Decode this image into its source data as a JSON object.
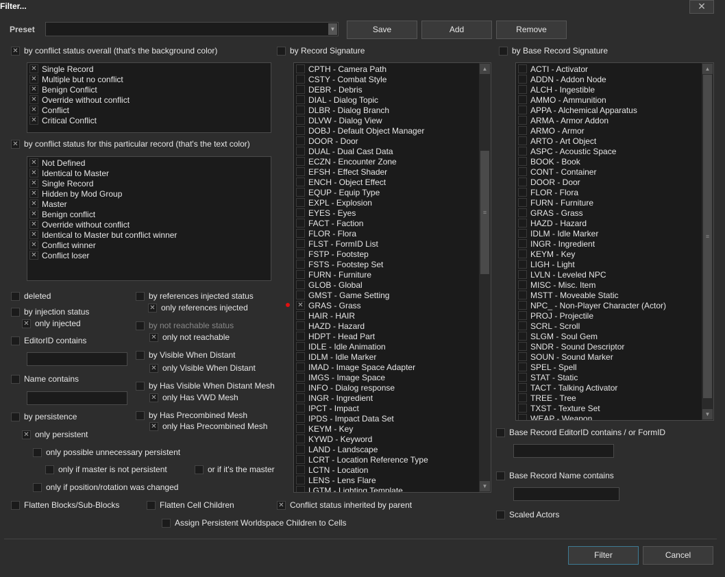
{
  "window": {
    "title": "Filter...",
    "close_label": "✕"
  },
  "preset": {
    "label": "Preset",
    "value": "",
    "save": "Save",
    "add": "Add",
    "remove": "Remove"
  },
  "overall": {
    "label": "by conflict status overall (that's the background color)",
    "checked": true,
    "items": [
      {
        "label": "Single Record",
        "checked": true
      },
      {
        "label": "Multiple but no conflict",
        "checked": true
      },
      {
        "label": "Benign Conflict",
        "checked": true
      },
      {
        "label": "Override without conflict",
        "checked": true
      },
      {
        "label": "Conflict",
        "checked": true
      },
      {
        "label": "Critical Conflict",
        "checked": true
      }
    ]
  },
  "particular": {
    "label": "by conflict status for this particular record  (that's the text color)",
    "checked": true,
    "items": [
      {
        "label": "Not Defined",
        "checked": true
      },
      {
        "label": "Identical to Master",
        "checked": true
      },
      {
        "label": "Single Record",
        "checked": true
      },
      {
        "label": "Hidden by Mod Group",
        "checked": true
      },
      {
        "label": "Master",
        "checked": true
      },
      {
        "label": "Benign conflict",
        "checked": true
      },
      {
        "label": "Override without conflict",
        "checked": true
      },
      {
        "label": "Identical to Master but conflict winner",
        "checked": true
      },
      {
        "label": "Conflict winner",
        "checked": true
      },
      {
        "label": "Conflict loser",
        "checked": true
      }
    ]
  },
  "options": {
    "deleted": "deleted",
    "injection": "by injection status",
    "only_injected": "only injected",
    "editorid": "EditorID contains",
    "editorid_value": "",
    "name": "Name contains",
    "name_value": "",
    "persistence": "by persistence",
    "only_persistent": "only persistent",
    "unnecessary": "only possible unnecessary persistent",
    "master_not_persistent": "only if master is not persistent",
    "or_master": "or if it's the master",
    "pos_changed": "only if position/rotation was changed",
    "refs_injected": "by references injected status",
    "only_refs_injected": "only references injected",
    "not_reachable": "by not reachable status",
    "only_not_reachable": "only not reachable",
    "vwd": "by Visible When Distant",
    "only_vwd": "only Visible When Distant",
    "vwd_mesh": "by Has Visible When Distant Mesh",
    "only_vwd_mesh": "only Has VWD Mesh",
    "precombined": "by Has Precombined Mesh",
    "only_precombined": "only Has Precombined Mesh",
    "flatten_blocks": "Flatten Blocks/Sub-Blocks",
    "flatten_cell": "Flatten Cell Children",
    "inherited": "Conflict status inherited by parent",
    "assign_persistent": "Assign Persistent Worldspace Children to Cells"
  },
  "record_signature": {
    "label": "by Record Signature",
    "checked": false,
    "items": [
      {
        "label": "CPTH - Camera Path"
      },
      {
        "label": "CSTY - Combat Style"
      },
      {
        "label": "DEBR - Debris"
      },
      {
        "label": "DIAL - Dialog Topic"
      },
      {
        "label": "DLBR - Dialog Branch"
      },
      {
        "label": "DLVW - Dialog View"
      },
      {
        "label": "DOBJ - Default Object Manager"
      },
      {
        "label": "DOOR - Door"
      },
      {
        "label": "DUAL - Dual Cast Data"
      },
      {
        "label": "ECZN - Encounter Zone"
      },
      {
        "label": "EFSH - Effect Shader"
      },
      {
        "label": "ENCH - Object Effect"
      },
      {
        "label": "EQUP - Equip Type"
      },
      {
        "label": "EXPL - Explosion"
      },
      {
        "label": "EYES - Eyes"
      },
      {
        "label": "FACT - Faction"
      },
      {
        "label": "FLOR - Flora"
      },
      {
        "label": "FLST - FormID List"
      },
      {
        "label": "FSTP - Footstep"
      },
      {
        "label": "FSTS - Footstep Set"
      },
      {
        "label": "FURN - Furniture"
      },
      {
        "label": "GLOB - Global"
      },
      {
        "label": "GMST - Game Setting"
      },
      {
        "label": "GRAS - Grass",
        "checked": true
      },
      {
        "label": "HAIR - HAIR"
      },
      {
        "label": "HAZD - Hazard"
      },
      {
        "label": "HDPT - Head Part"
      },
      {
        "label": "IDLE - Idle Animation"
      },
      {
        "label": "IDLM - Idle Marker"
      },
      {
        "label": "IMAD - Image Space Adapter"
      },
      {
        "label": "IMGS - Image Space"
      },
      {
        "label": "INFO - Dialog response"
      },
      {
        "label": "INGR - Ingredient"
      },
      {
        "label": "IPCT - Impact"
      },
      {
        "label": "IPDS - Impact Data Set"
      },
      {
        "label": "KEYM - Key"
      },
      {
        "label": "KYWD - Keyword"
      },
      {
        "label": "LAND - Landscape"
      },
      {
        "label": "LCRT - Location Reference Type"
      },
      {
        "label": "LCTN - Location"
      },
      {
        "label": "LENS - Lens Flare"
      },
      {
        "label": "LGTM - Lighting Template"
      }
    ]
  },
  "base_signature": {
    "label": "by Base Record Signature",
    "checked": false,
    "items": [
      {
        "label": "ACTI - Activator"
      },
      {
        "label": "ADDN - Addon Node"
      },
      {
        "label": "ALCH - Ingestible"
      },
      {
        "label": "AMMO - Ammunition"
      },
      {
        "label": "APPA - Alchemical Apparatus"
      },
      {
        "label": "ARMA - Armor Addon"
      },
      {
        "label": "ARMO - Armor"
      },
      {
        "label": "ARTO - Art Object"
      },
      {
        "label": "ASPC - Acoustic Space"
      },
      {
        "label": "BOOK - Book"
      },
      {
        "label": "CONT - Container"
      },
      {
        "label": "DOOR - Door"
      },
      {
        "label": "FLOR - Flora"
      },
      {
        "label": "FURN - Furniture"
      },
      {
        "label": "GRAS - Grass"
      },
      {
        "label": "HAZD - Hazard"
      },
      {
        "label": "IDLM - Idle Marker"
      },
      {
        "label": "INGR - Ingredient"
      },
      {
        "label": "KEYM - Key"
      },
      {
        "label": "LIGH - Light"
      },
      {
        "label": "LVLN - Leveled NPC"
      },
      {
        "label": "MISC - Misc. Item"
      },
      {
        "label": "MSTT - Moveable Static"
      },
      {
        "label": "NPC_ - Non-Player Character (Actor)"
      },
      {
        "label": "PROJ - Projectile"
      },
      {
        "label": "SCRL - Scroll"
      },
      {
        "label": "SLGM - Soul Gem"
      },
      {
        "label": "SNDR - Sound Descriptor"
      },
      {
        "label": "SOUN - Sound Marker"
      },
      {
        "label": "SPEL - Spell"
      },
      {
        "label": "STAT - Static"
      },
      {
        "label": "TACT - Talking Activator"
      },
      {
        "label": "TREE - Tree"
      },
      {
        "label": "TXST - Texture Set"
      },
      {
        "label": "WEAP - Weapon"
      }
    ]
  },
  "base_filters": {
    "editorid": "Base Record EditorID contains / or FormID",
    "editorid_value": "",
    "name": "Base Record Name contains",
    "name_value": "",
    "scaled": "Scaled Actors"
  },
  "footer": {
    "filter": "Filter",
    "cancel": "Cancel"
  }
}
